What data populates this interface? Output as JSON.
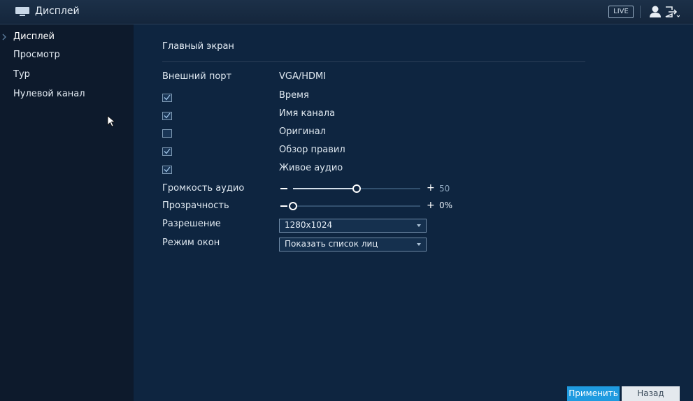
{
  "header": {
    "title": "Дисплей",
    "live_badge": "LIVE",
    "icons": [
      "monitor-icon",
      "user-icon",
      "logout-icon"
    ]
  },
  "sidebar": {
    "items": [
      {
        "label": "Дисплей",
        "active": true
      },
      {
        "label": "Просмотр",
        "active": false
      },
      {
        "label": "Тур",
        "active": false
      },
      {
        "label": "Нулевой канал",
        "active": false
      }
    ]
  },
  "main": {
    "section_title": "Главный экран",
    "output_port": {
      "label": "Внешний порт",
      "value": "VGA/HDMI"
    },
    "checkboxes": [
      {
        "label": "Время",
        "checked": true
      },
      {
        "label": "Имя канала",
        "checked": true
      },
      {
        "label": "Оригинал",
        "checked": false
      },
      {
        "label": "Обзор правил",
        "checked": true
      },
      {
        "label": "Живое аудио",
        "checked": true
      }
    ],
    "audio_volume": {
      "label": "Громкость аудио",
      "value": 50,
      "display": "50"
    },
    "transparency": {
      "label": "Прозрачность",
      "value": 0,
      "display": "0%"
    },
    "resolution": {
      "label": "Разрешение",
      "selected": "1280x1024"
    },
    "window_mode": {
      "label": "Режим окон",
      "selected": "Показать список лиц"
    }
  },
  "footer": {
    "apply_label": "Применить",
    "back_label": "Назад"
  },
  "colors": {
    "accent": "#1f9be0",
    "background": "#0e2540",
    "sidebar": "#0d1a2c"
  }
}
